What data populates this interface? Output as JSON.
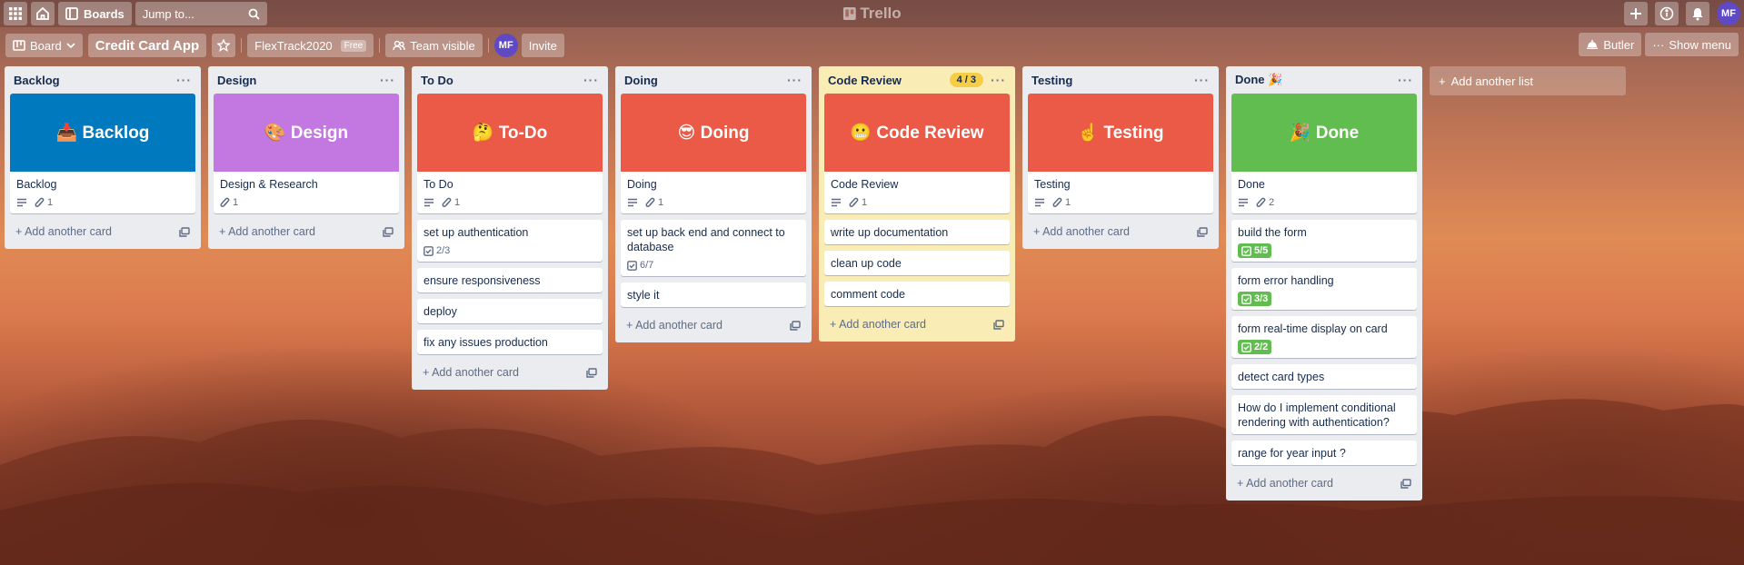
{
  "header": {
    "boards_label": "Boards",
    "search_placeholder": "Jump to...",
    "logo_text": "Trello",
    "avatar": "MF"
  },
  "board_header": {
    "view_label": "Board",
    "title": "Credit Card App",
    "workspace": "FlexTrack2020",
    "workspace_plan": "Free",
    "visibility": "Team visible",
    "member_avatar": "MF",
    "invite_label": "Invite",
    "butler_label": "Butler",
    "menu_label": "Show menu"
  },
  "lists": [
    {
      "title": "Backlog",
      "cover": {
        "text": "📥 Backlog",
        "color": "#0079bf"
      },
      "cards": [
        {
          "title": "Backlog",
          "desc": true,
          "attachments": "1"
        }
      ],
      "add_label": "Add another card"
    },
    {
      "title": "Design",
      "cover": {
        "text": "🎨 Design",
        "color": "#c377e0"
      },
      "cards": [
        {
          "title": "Design & Research",
          "attachments": "1"
        }
      ],
      "add_label": "Add another card"
    },
    {
      "title": "To Do",
      "cover": {
        "text": "🤔 To-Do",
        "color": "#eb5a46"
      },
      "cards": [
        {
          "title": "To Do",
          "desc": true,
          "attachments": "1"
        },
        {
          "title": "set up authentication",
          "checklist": "2/3"
        },
        {
          "title": "ensure responsiveness"
        },
        {
          "title": "deploy"
        },
        {
          "title": "fix any issues production"
        }
      ],
      "add_label": "Add another card"
    },
    {
      "title": "Doing",
      "cover": {
        "text": "😎 Doing",
        "color": "#eb5a46"
      },
      "cards": [
        {
          "title": "Doing",
          "desc": true,
          "attachments": "1"
        },
        {
          "title": "set up back end and connect to database",
          "checklist": "6/7"
        },
        {
          "title": "style it"
        }
      ],
      "add_label": "Add another card"
    },
    {
      "title": "Code Review",
      "limit": "4 / 3",
      "cover": {
        "text": "😬 Code Review",
        "color": "#eb5a46"
      },
      "cards": [
        {
          "title": "Code Review",
          "desc": true,
          "attachments": "1"
        },
        {
          "title": "write up documentation"
        },
        {
          "title": "clean up code"
        },
        {
          "title": "comment code"
        }
      ],
      "add_label": "Add another card"
    },
    {
      "title": "Testing",
      "cover": {
        "text": "☝️ Testing",
        "color": "#eb5a46"
      },
      "cards": [
        {
          "title": "Testing",
          "desc": true,
          "attachments": "1"
        }
      ],
      "add_label": "Add another card"
    },
    {
      "title": "Done 🎉",
      "cover": {
        "text": "🎉 Done",
        "color": "#61bd4f"
      },
      "cards": [
        {
          "title": "Done",
          "desc": true,
          "attachments": "2"
        },
        {
          "title": "build the form",
          "checklist_done": "5/5"
        },
        {
          "title": "form error handling",
          "checklist_done": "3/3"
        },
        {
          "title": "form real-time display on card",
          "checklist_done": "2/2"
        },
        {
          "title": "detect card types"
        },
        {
          "title": "How do I implement conditional rendering with authentication?"
        },
        {
          "title": "range for year input ?"
        }
      ],
      "add_label": "Add another card"
    }
  ],
  "add_list_label": "Add another list",
  "colors": {
    "list_bg": "#ebecf0",
    "review_list_bg": "#f9ecb4",
    "limit_badge": "#f5cd47",
    "done_badge": "#61bd4f"
  }
}
